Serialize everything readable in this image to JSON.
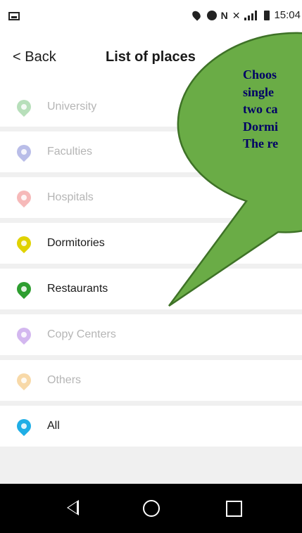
{
  "status_bar": {
    "time": "15:04",
    "icons": [
      "gallery-icon",
      "location-icon",
      "bluetooth-icon",
      "nfc-icon",
      "vibrate-icon",
      "lte-signal-icon",
      "battery-icon"
    ]
  },
  "app_bar": {
    "back_label": "< Back",
    "title": "List of places"
  },
  "places": [
    {
      "label": "University",
      "color": "#b7dfba",
      "enabled": false
    },
    {
      "label": "Faculties",
      "color": "#b9bde8",
      "enabled": false
    },
    {
      "label": "Hospitals",
      "color": "#f6b9b9",
      "enabled": false
    },
    {
      "label": "Dormitories",
      "color": "#e0d200",
      "enabled": true
    },
    {
      "label": "Restaurants",
      "color": "#2e9e30",
      "enabled": true
    },
    {
      "label": "Copy Centers",
      "color": "#d3b7ef",
      "enabled": false
    },
    {
      "label": "Others",
      "color": "#f8d9a8",
      "enabled": false
    },
    {
      "label": "All",
      "color": "#1faee6",
      "enabled": true
    }
  ],
  "callout": {
    "lines": [
      "Choos",
      "single",
      "two ca",
      "Dormi",
      "The re"
    ],
    "fill": "#6aac46",
    "stroke": "#3e7227",
    "text_color": "#000066"
  },
  "nav_bar": {
    "icons": [
      "back-triangle-icon",
      "home-circle-icon",
      "recents-square-icon"
    ]
  }
}
